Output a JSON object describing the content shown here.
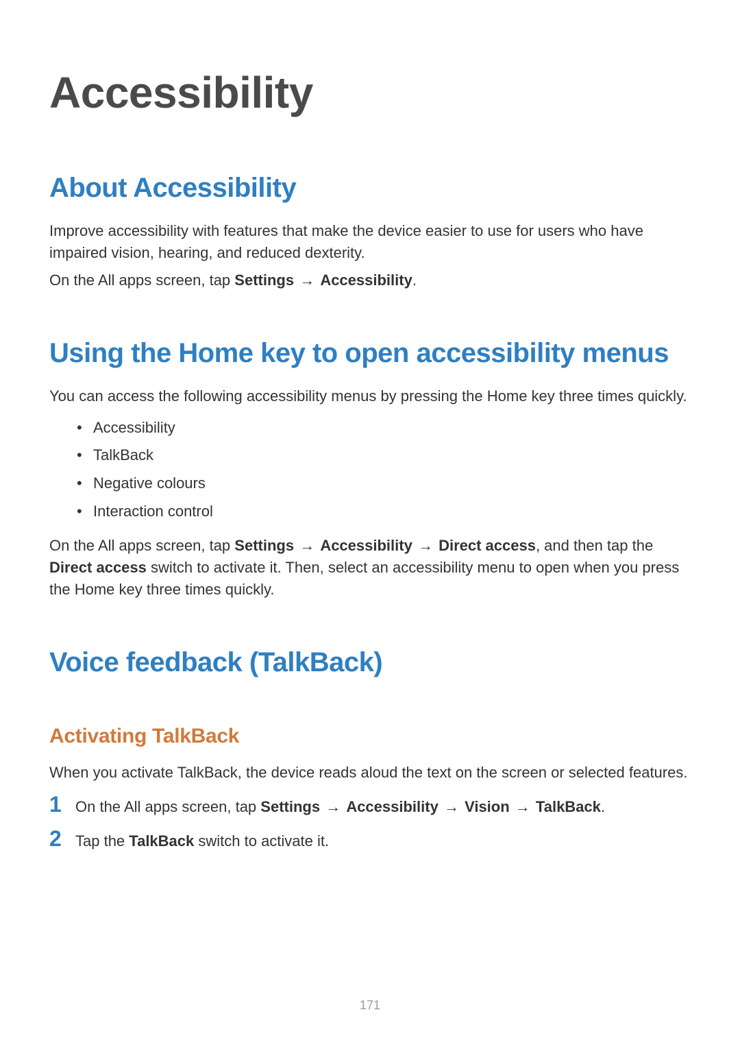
{
  "page_number": "171",
  "title": "Accessibility",
  "section1": {
    "heading": "About Accessibility",
    "para1": "Improve accessibility with features that make the device easier to use for users who have impaired vision, hearing, and reduced dexterity.",
    "para2_pre": "On the All apps screen, tap ",
    "para2_b1": "Settings",
    "para2_arrow": " → ",
    "para2_b2": "Accessibility",
    "para2_post": "."
  },
  "section2": {
    "heading": "Using the Home key to open accessibility menus",
    "intro": "You can access the following accessibility menus by pressing the Home key three times quickly.",
    "bullets": [
      "Accessibility",
      "TalkBack",
      "Negative colours",
      "Interaction control"
    ],
    "after_pre": "On the All apps screen, tap ",
    "after_b1": "Settings",
    "after_arrow1": " → ",
    "after_b2": "Accessibility",
    "after_arrow2": " → ",
    "after_b3": "Direct access",
    "after_mid1": ", and then tap the ",
    "after_b4": "Direct access",
    "after_post": " switch to activate it. Then, select an accessibility menu to open when you press the Home key three times quickly."
  },
  "section3": {
    "heading": "Voice feedback (TalkBack)",
    "sub": {
      "heading": "Activating TalkBack",
      "para": "When you activate TalkBack, the device reads aloud the text on the screen or selected features.",
      "steps": [
        {
          "num": "1",
          "pre": "On the All apps screen, tap ",
          "b1": "Settings",
          "a1": " → ",
          "b2": "Accessibility",
          "a2": " → ",
          "b3": "Vision",
          "a3": " → ",
          "b4": "TalkBack",
          "post": "."
        },
        {
          "num": "2",
          "pre": "Tap the ",
          "b1": "TalkBack",
          "post": " switch to activate it."
        }
      ]
    }
  }
}
